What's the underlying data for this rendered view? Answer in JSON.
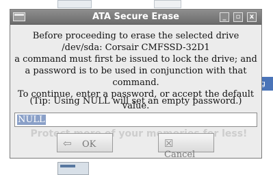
{
  "background": {
    "side_tab_label": "g"
  },
  "dialog": {
    "title": "ATA Secure Erase",
    "window_buttons": {
      "minimize_glyph": "_",
      "maximize_glyph": "▫",
      "close_glyph": "x"
    },
    "message_lines": [
      "Before proceeding to erase the selected drive",
      "/dev/sda: Corsair CMFSSD-32D1",
      "a command must first be issued to lock the drive; and",
      "a password is to be used in conjunction with that command.",
      "To continue, enter a password, or accept the default value."
    ],
    "tip": "(Tip:  Using NULL will set an empty password.)",
    "password_value": "NULL",
    "watermark": "Protect more of your memories for less!",
    "ok_label": "OK",
    "cancel_label": "Cancel",
    "ok_icon": "back-arrow-icon",
    "cancel_icon": "cancel-x-icon"
  }
}
